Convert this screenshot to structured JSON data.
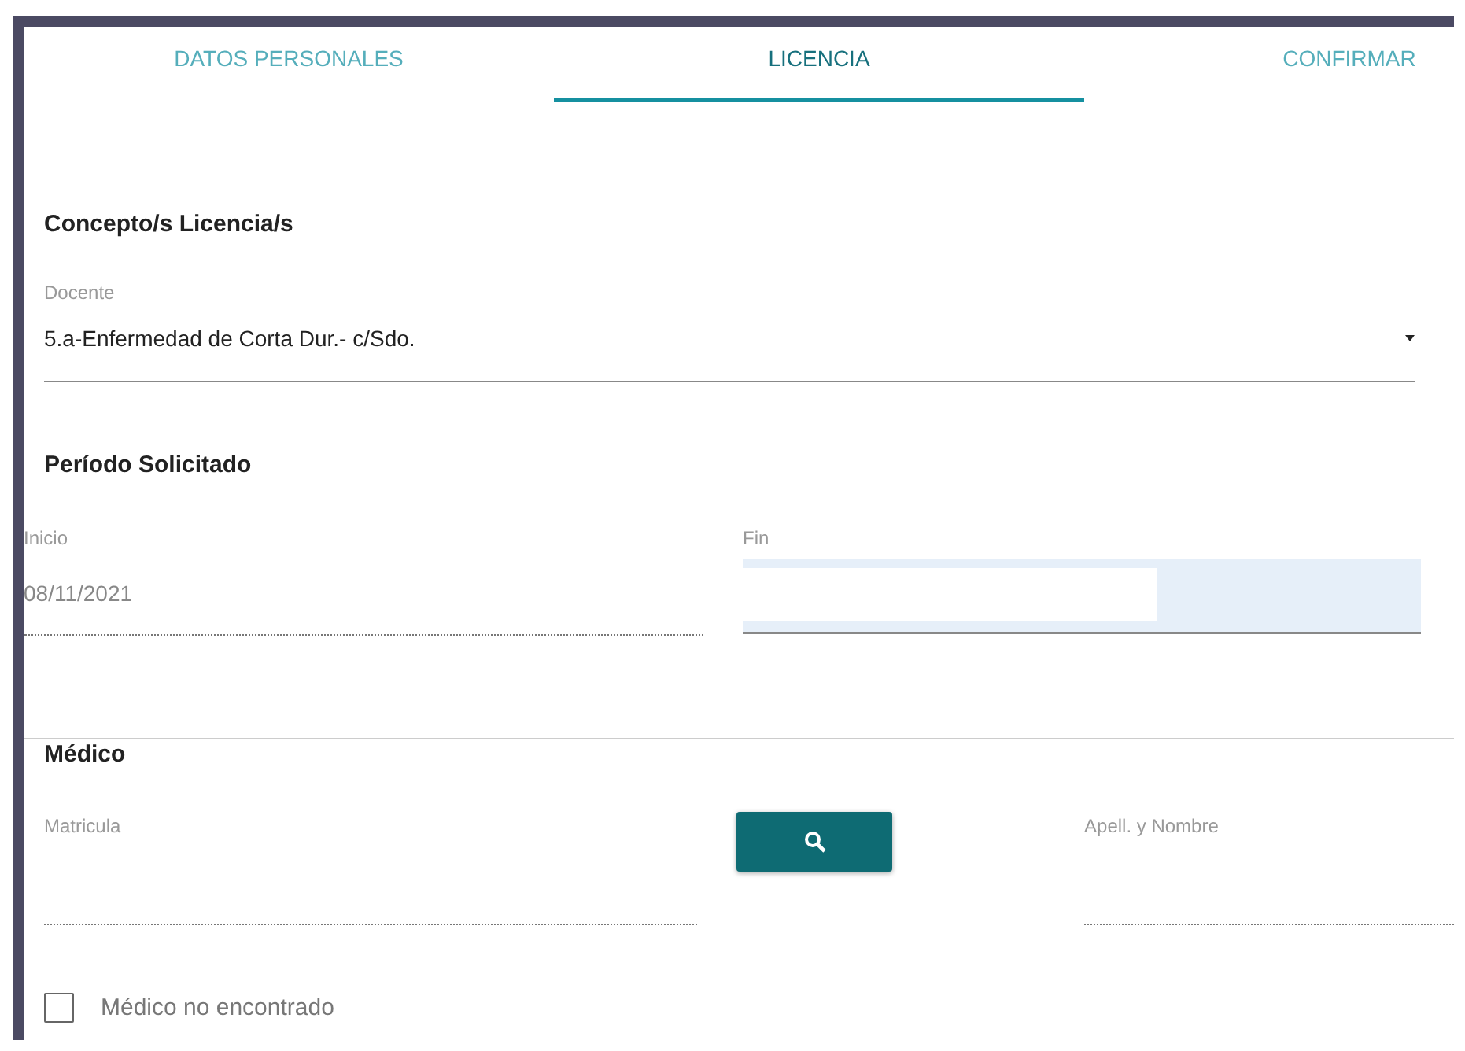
{
  "tabs": [
    {
      "label": "DATOS PERSONALES",
      "selected": false
    },
    {
      "label": "LICENCIA",
      "selected": true
    },
    {
      "label": "CONFIRMAR",
      "selected": false
    }
  ],
  "concepto": {
    "heading": "Concepto/s Licencia/s",
    "field": {
      "label": "Docente",
      "value": "5.a-Enfermedad de Corta Dur.- c/Sdo."
    }
  },
  "periodo": {
    "heading": "Período Solicitado",
    "inicio": {
      "label": "Inicio",
      "value": "08/11/2021",
      "disabled": true
    },
    "fin": {
      "label": "Fin",
      "focused": true
    }
  },
  "medico": {
    "heading": "Médico",
    "matricula": {
      "label": "Matricula"
    },
    "nombre": {
      "label": "Apell. y Nombre"
    },
    "not_found": {
      "label": "Médico no encontrado",
      "checked": false
    }
  }
}
